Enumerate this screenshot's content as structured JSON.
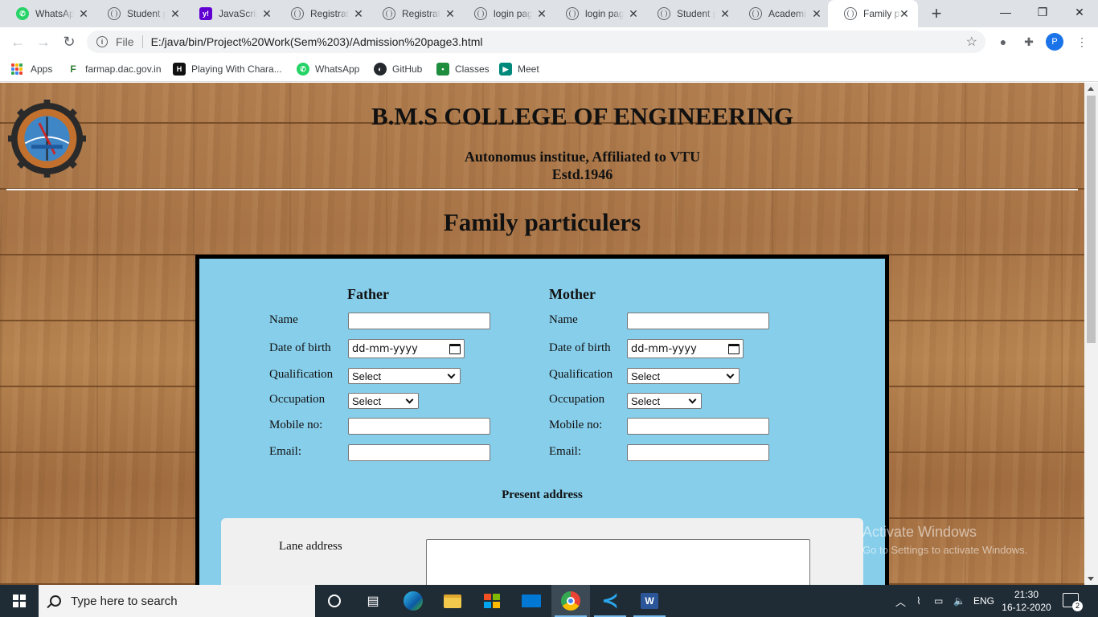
{
  "browser": {
    "tabs": [
      {
        "label": "WhatsApp",
        "favicon": "whatsapp-icon",
        "active": false
      },
      {
        "label": "Student p",
        "favicon": "globe-icon",
        "active": false
      },
      {
        "label": "JavaScrip",
        "favicon": "yahoo-icon",
        "active": false
      },
      {
        "label": "Registrati",
        "favicon": "globe-icon",
        "active": false
      },
      {
        "label": "Registrati",
        "favicon": "globe-icon",
        "active": false
      },
      {
        "label": "login pag",
        "favicon": "globe-icon",
        "active": false
      },
      {
        "label": "login pag",
        "favicon": "globe-icon",
        "active": false
      },
      {
        "label": "Student p",
        "favicon": "globe-icon",
        "active": false
      },
      {
        "label": "Academi",
        "favicon": "globe-icon",
        "active": false
      },
      {
        "label": "Family pa",
        "favicon": "globe-icon",
        "active": true
      }
    ],
    "new_tab_symbol": "+",
    "window_controls": {
      "minimize": "—",
      "restore": "❐",
      "close": "✕"
    },
    "address": {
      "scheme_label": "File",
      "url": "E:/java/bin/Project%20Work(Sem%203)/Admission%20page3.html"
    },
    "profile_initial": "P",
    "bookmarks": [
      {
        "label": "Apps",
        "icon": "apps-grid-icon"
      },
      {
        "label": "farmap.dac.gov.in",
        "icon": "farmap-icon"
      },
      {
        "label": "Playing With Chara...",
        "icon": "hackerrank-icon"
      },
      {
        "label": "WhatsApp",
        "icon": "whatsapp-icon"
      },
      {
        "label": "GitHub",
        "icon": "github-icon"
      },
      {
        "label": "Classes",
        "icon": "classroom-icon"
      },
      {
        "label": "Meet",
        "icon": "meet-icon"
      }
    ]
  },
  "page": {
    "college_name": "B.M.S COLLEGE OF ENGINEERING",
    "college_tagline": "Autonomus institue, Affiliated to VTU",
    "college_estd": "Estd.1946",
    "title": "Family particulers",
    "father": {
      "heading": "Father",
      "labels": {
        "name": "Name",
        "dob": "Date of birth",
        "qualification": "Qualification",
        "occupation": "Occupation",
        "mobile": "Mobile no:",
        "email": "Email:"
      },
      "dob_placeholder": "dd-mm-yyyy",
      "qualification_value": "Select",
      "occupation_value": "Select"
    },
    "mother": {
      "heading": "Mother",
      "labels": {
        "name": "Name",
        "dob": "Date of birth",
        "qualification": "Qualification",
        "occupation": "Occupation",
        "mobile": "Mobile no:",
        "email": "Email:"
      },
      "dob_placeholder": "dd-mm-yyyy",
      "qualification_value": "Select",
      "occupation_value": "Select"
    },
    "present_address": {
      "heading": "Present address",
      "lane_label": "Lane address"
    },
    "activation_watermark": {
      "title": "Activate Windows",
      "subtitle": "Go to Settings to activate Windows."
    }
  },
  "taskbar": {
    "search_placeholder": "Type here to search",
    "language": "ENG",
    "time": "21:30",
    "date": "16-12-2020",
    "notification_count": "2"
  },
  "colors": {
    "form_background": "#87ceeb",
    "form_border": "#000000",
    "chrome_tabstrip": "#dee1e6",
    "taskbar": "#1f2c36"
  }
}
